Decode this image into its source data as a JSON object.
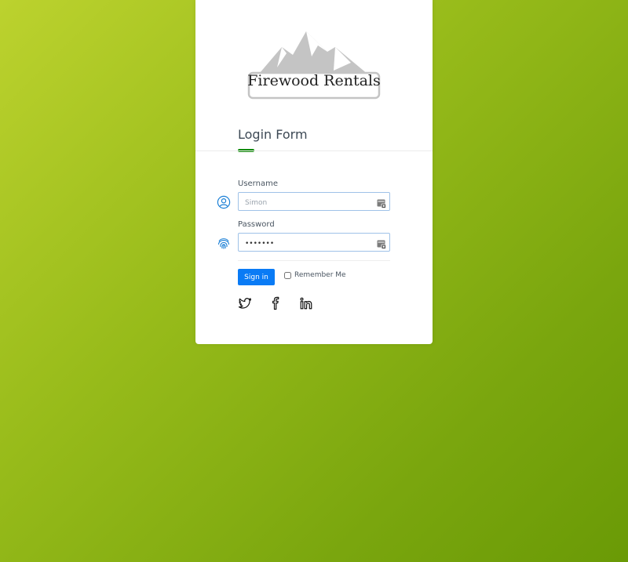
{
  "logo": {
    "text": "Firewood Rentals"
  },
  "form": {
    "title": "Login Form",
    "username": {
      "label": "Username",
      "placeholder": "Simon",
      "value": ""
    },
    "password": {
      "label": "Password",
      "value": "•••••••"
    },
    "sign_in_label": "Sign in",
    "remember_label": "Remember Me"
  },
  "social": {
    "icons": [
      "twitter-icon",
      "facebook-icon",
      "linkedin-icon"
    ]
  },
  "colors": {
    "accent": "#0f8a07",
    "button": "#0a7bf5",
    "input_icon": "#1a7fd6"
  }
}
